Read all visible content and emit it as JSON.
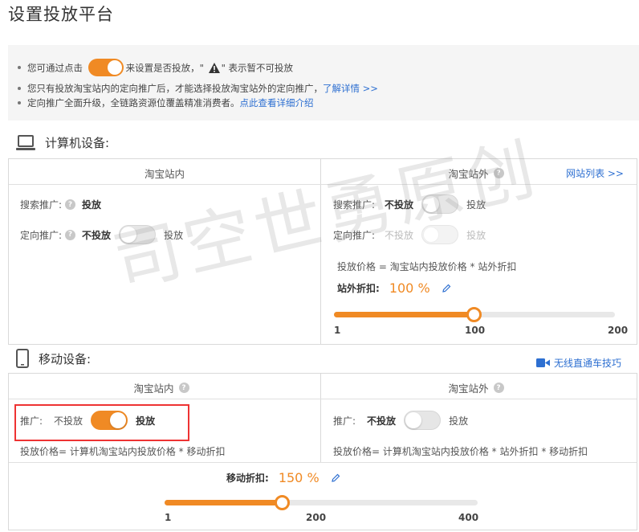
{
  "page_title": "设置投放平台",
  "notice": {
    "line1_before": "您可通过点击",
    "line1_after": "来设置是否投放，\"",
    "line1_end": "\" 表示暂不可投放",
    "line2_text": "您只有投放淘宝站内的定向推广后，才能选择投放淘宝站外的定向推广，",
    "line2_link": "了解详情 >>",
    "line3_text": "定向推广全面升级，全链路资源位覆盖精准消费者。",
    "line3_link": "点此查看详细介绍"
  },
  "computer": {
    "heading": "计算机设备:",
    "inside": {
      "title": "淘宝站内",
      "search_label": "搜索推广:",
      "search_value": "投放",
      "target_label": "定向推广:",
      "target_off": "不投放",
      "target_on": "投放"
    },
    "outside": {
      "title": "淘宝站外",
      "site_list_link": "网站列表 >>",
      "search_label": "搜索推广:",
      "search_off": "不投放",
      "search_on": "投放",
      "target_label": "定向推广:",
      "target_off": "不投放",
      "target_on": "投放",
      "formula": "投放价格 = 淘宝站内投放价格 * 站外折扣",
      "discount_label": "站外折扣:",
      "discount_value": "100 %",
      "slider": {
        "min": "1",
        "mid": "100",
        "max": "200",
        "value": 100
      }
    }
  },
  "mobile": {
    "heading": "移动设备:",
    "tips_link": "无线直通车技巧",
    "inside": {
      "title": "淘宝站内",
      "promo_label": "推广:",
      "promo_off": "不投放",
      "promo_on": "投放",
      "formula": "投放价格= 计算机淘宝站内投放价格 * 移动折扣"
    },
    "outside": {
      "title": "淘宝站外",
      "promo_label": "推广:",
      "promo_off": "不投放",
      "promo_on": "投放",
      "formula": "投放价格= 计算机淘宝站内投放价格 * 站外折扣 * 移动折扣"
    },
    "discount_label": "移动折扣:",
    "discount_value": "150 %",
    "slider": {
      "min": "1",
      "mid": "200",
      "max": "400",
      "value": 150
    }
  },
  "watermark": "司空世勇原创",
  "colors": {
    "accent": "#f08a24",
    "link": "#2d6fd1",
    "highlight": "#e33333"
  }
}
